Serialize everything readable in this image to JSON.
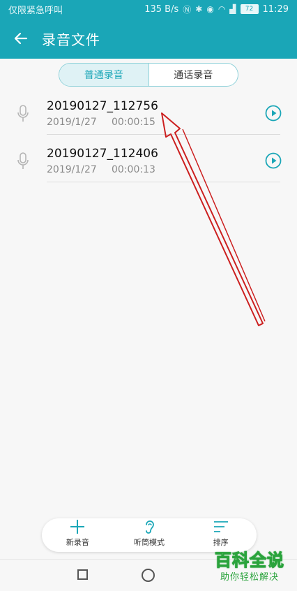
{
  "status_bar": {
    "left_text": "仅限紧急呼叫",
    "speed": "135 B/s",
    "battery": "72",
    "time": "11:29"
  },
  "app_bar": {
    "title": "录音文件"
  },
  "tabs": [
    {
      "label": "普通录音",
      "active": true
    },
    {
      "label": "通话录音",
      "active": false
    }
  ],
  "recordings": [
    {
      "name": "20190127_112756",
      "date": "2019/1/27",
      "duration": "00:00:15"
    },
    {
      "name": "20190127_112406",
      "date": "2019/1/27",
      "duration": "00:00:13"
    }
  ],
  "bottom_actions": [
    {
      "label": "新录音",
      "icon": "plus-icon"
    },
    {
      "label": "听筒模式",
      "icon": "ear-icon"
    },
    {
      "label": "排序",
      "icon": "sort-icon"
    }
  ],
  "watermark": {
    "big": "百科全说",
    "small": "助你轻松解决"
  },
  "colors": {
    "accent": "#1aa6b7",
    "annotation_arrow": "#cc1f1f",
    "watermark": "#2aa33c"
  }
}
